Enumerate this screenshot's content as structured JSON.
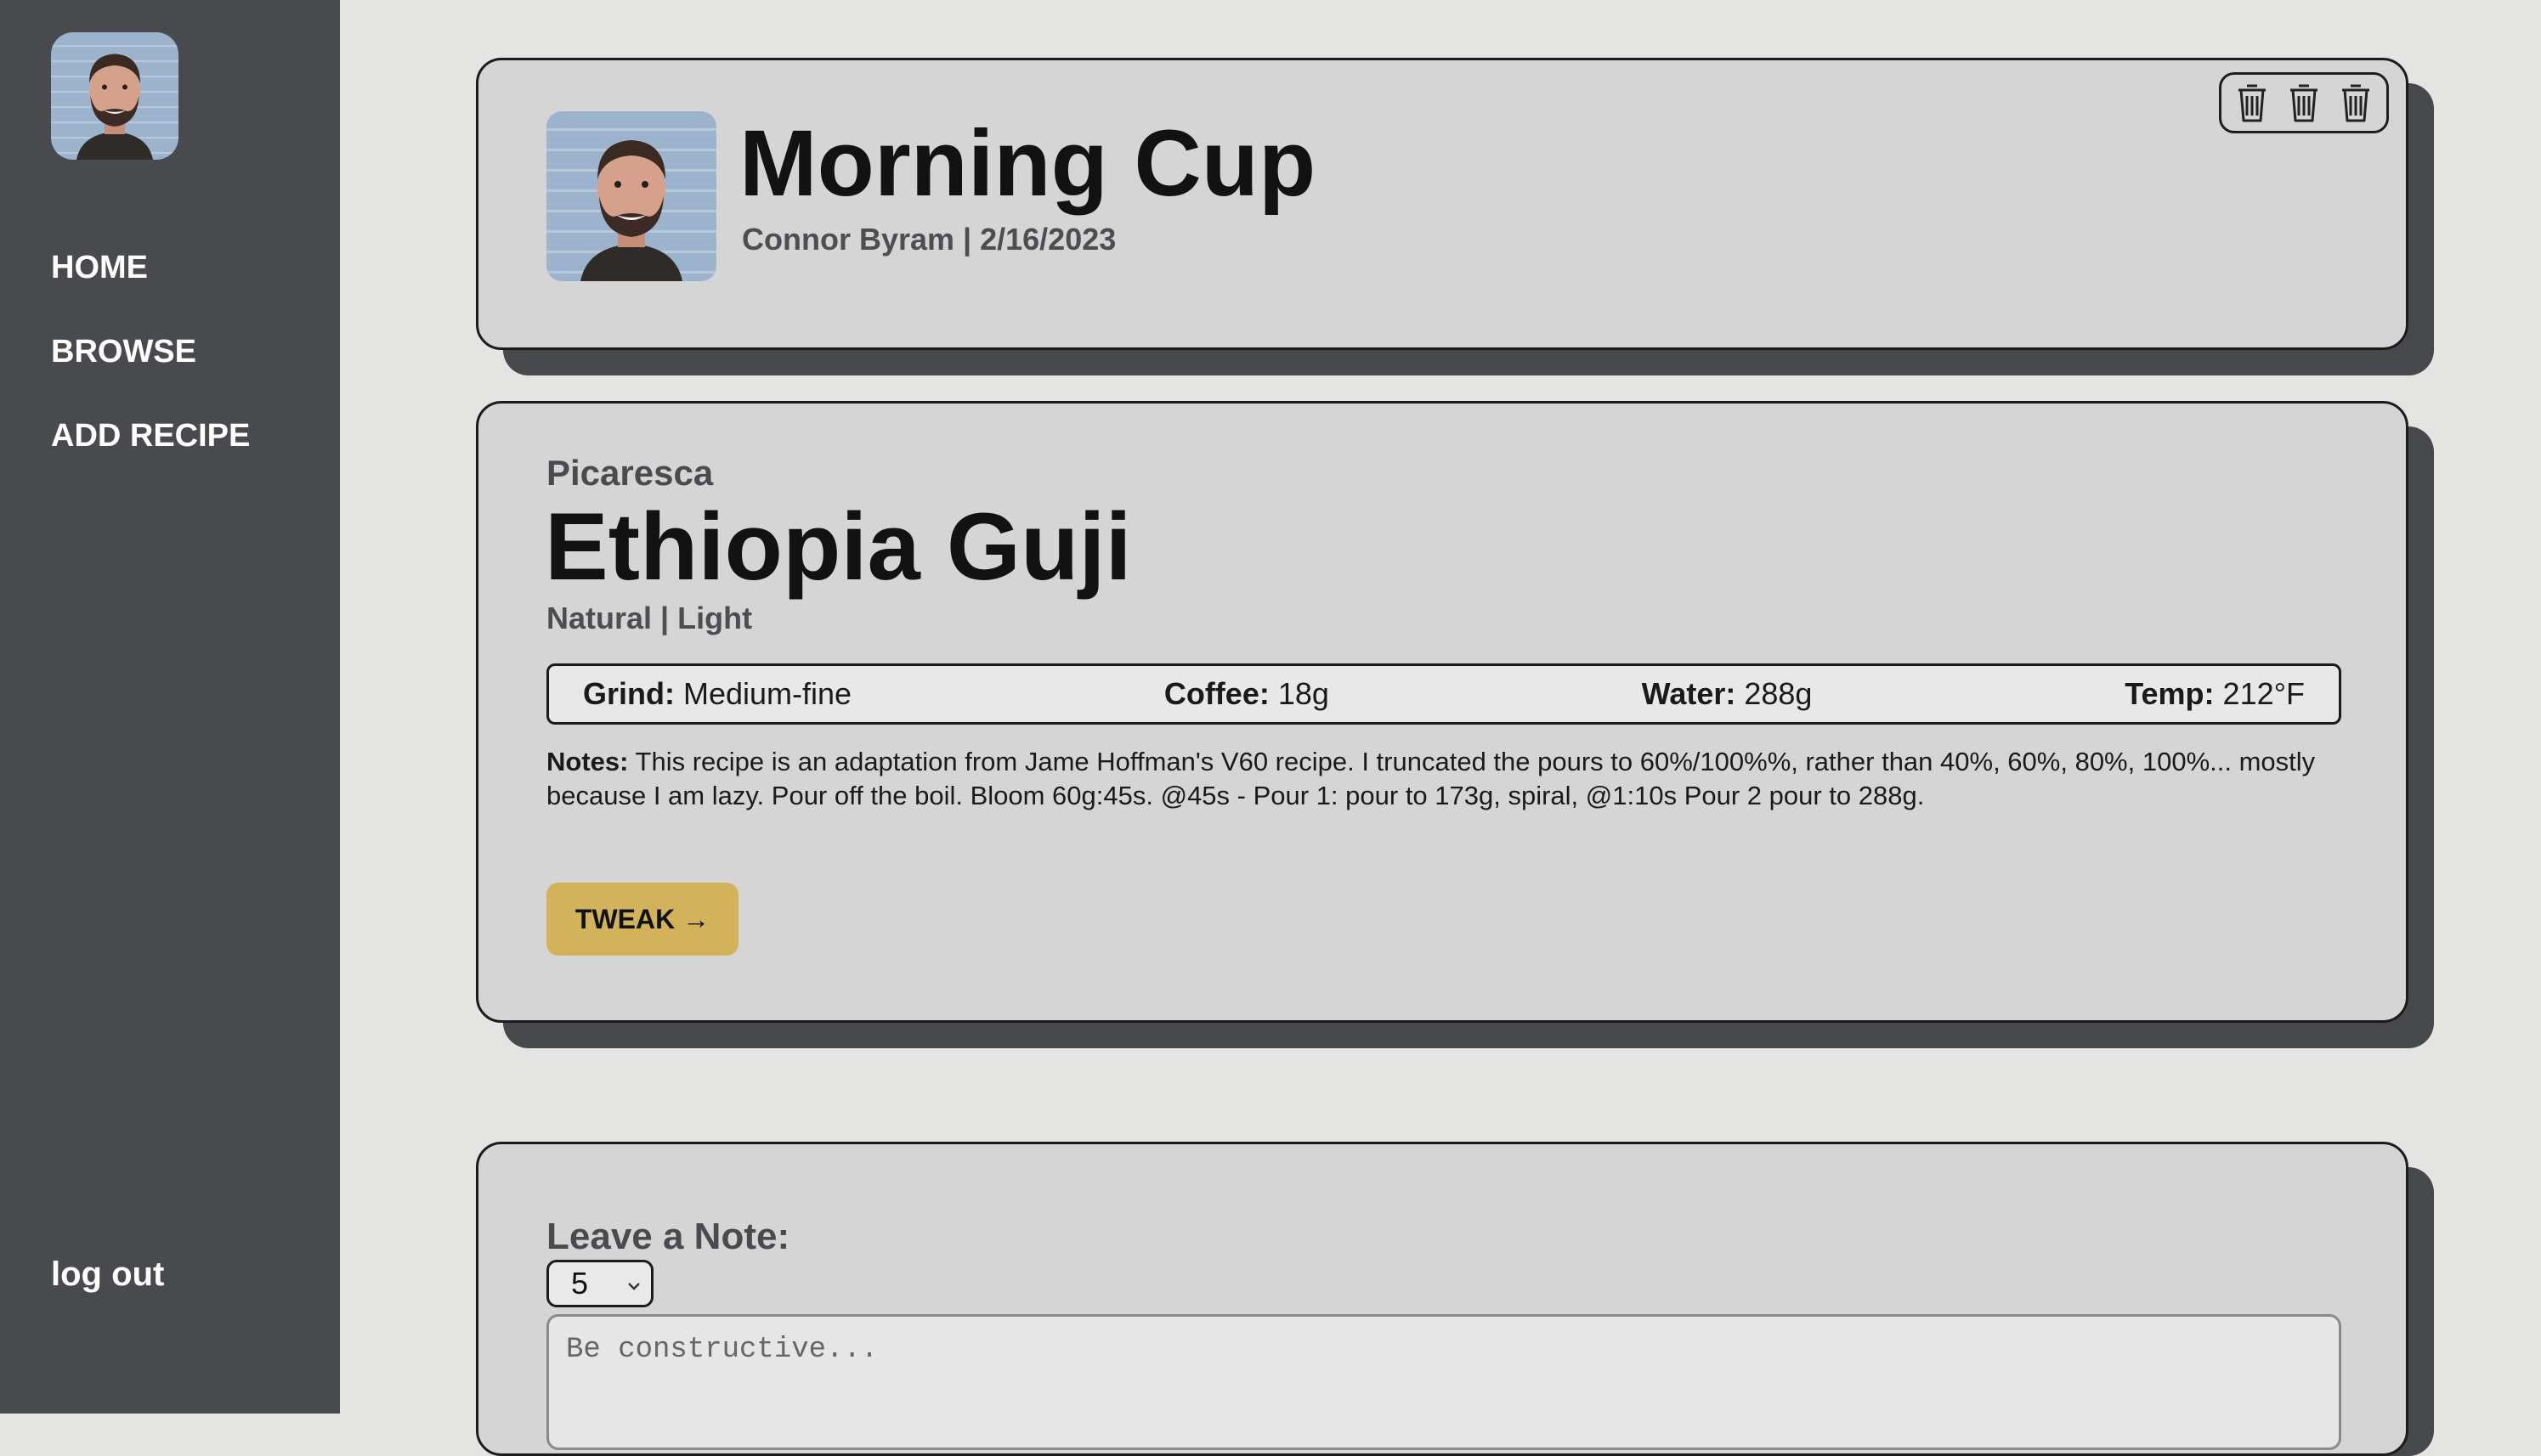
{
  "sidebar": {
    "nav": [
      {
        "label": "HOME"
      },
      {
        "label": "BROWSE"
      },
      {
        "label": "ADD RECIPE"
      }
    ],
    "logout_label": "log out"
  },
  "recipe_header": {
    "title": "Morning Cup",
    "byline": "Connor Byram | 2/16/2023",
    "action_icons": [
      "trash-icon",
      "trash-icon",
      "trash-icon"
    ]
  },
  "coffee": {
    "roaster": "Picaresca",
    "name": "Ethiopia Guji",
    "process_roast": "Natural | Light",
    "params": {
      "grind_label": "Grind:",
      "grind_value": "Medium-fine",
      "coffee_label": "Coffee:",
      "coffee_value": "18g",
      "water_label": "Water:",
      "water_value": "288g",
      "temp_label": "Temp:",
      "temp_value": "212°F"
    },
    "notes_label": "Notes:",
    "notes_text": "This recipe is an adaptation from Jame Hoffman's V60 recipe. I truncated the pours to 60%/100%%, rather than 40%, 60%, 80%, 100%... mostly because I am lazy. Pour off the boil. Bloom 60g:45s. @45s - Pour 1: pour to 173g, spiral, @1:10s Pour 2 pour to 288g.",
    "tweak_label": "TWEAK →"
  },
  "leave_note": {
    "label": "Leave a Note:",
    "rating_value": "5",
    "placeholder": "Be constructive..."
  },
  "colors": {
    "sidebar": "#484a4e",
    "page_bg": "#e4e4e3",
    "card_bg": "#d5d5d5",
    "card_shadow": "#47484c",
    "accent_button": "#d3b25c"
  }
}
